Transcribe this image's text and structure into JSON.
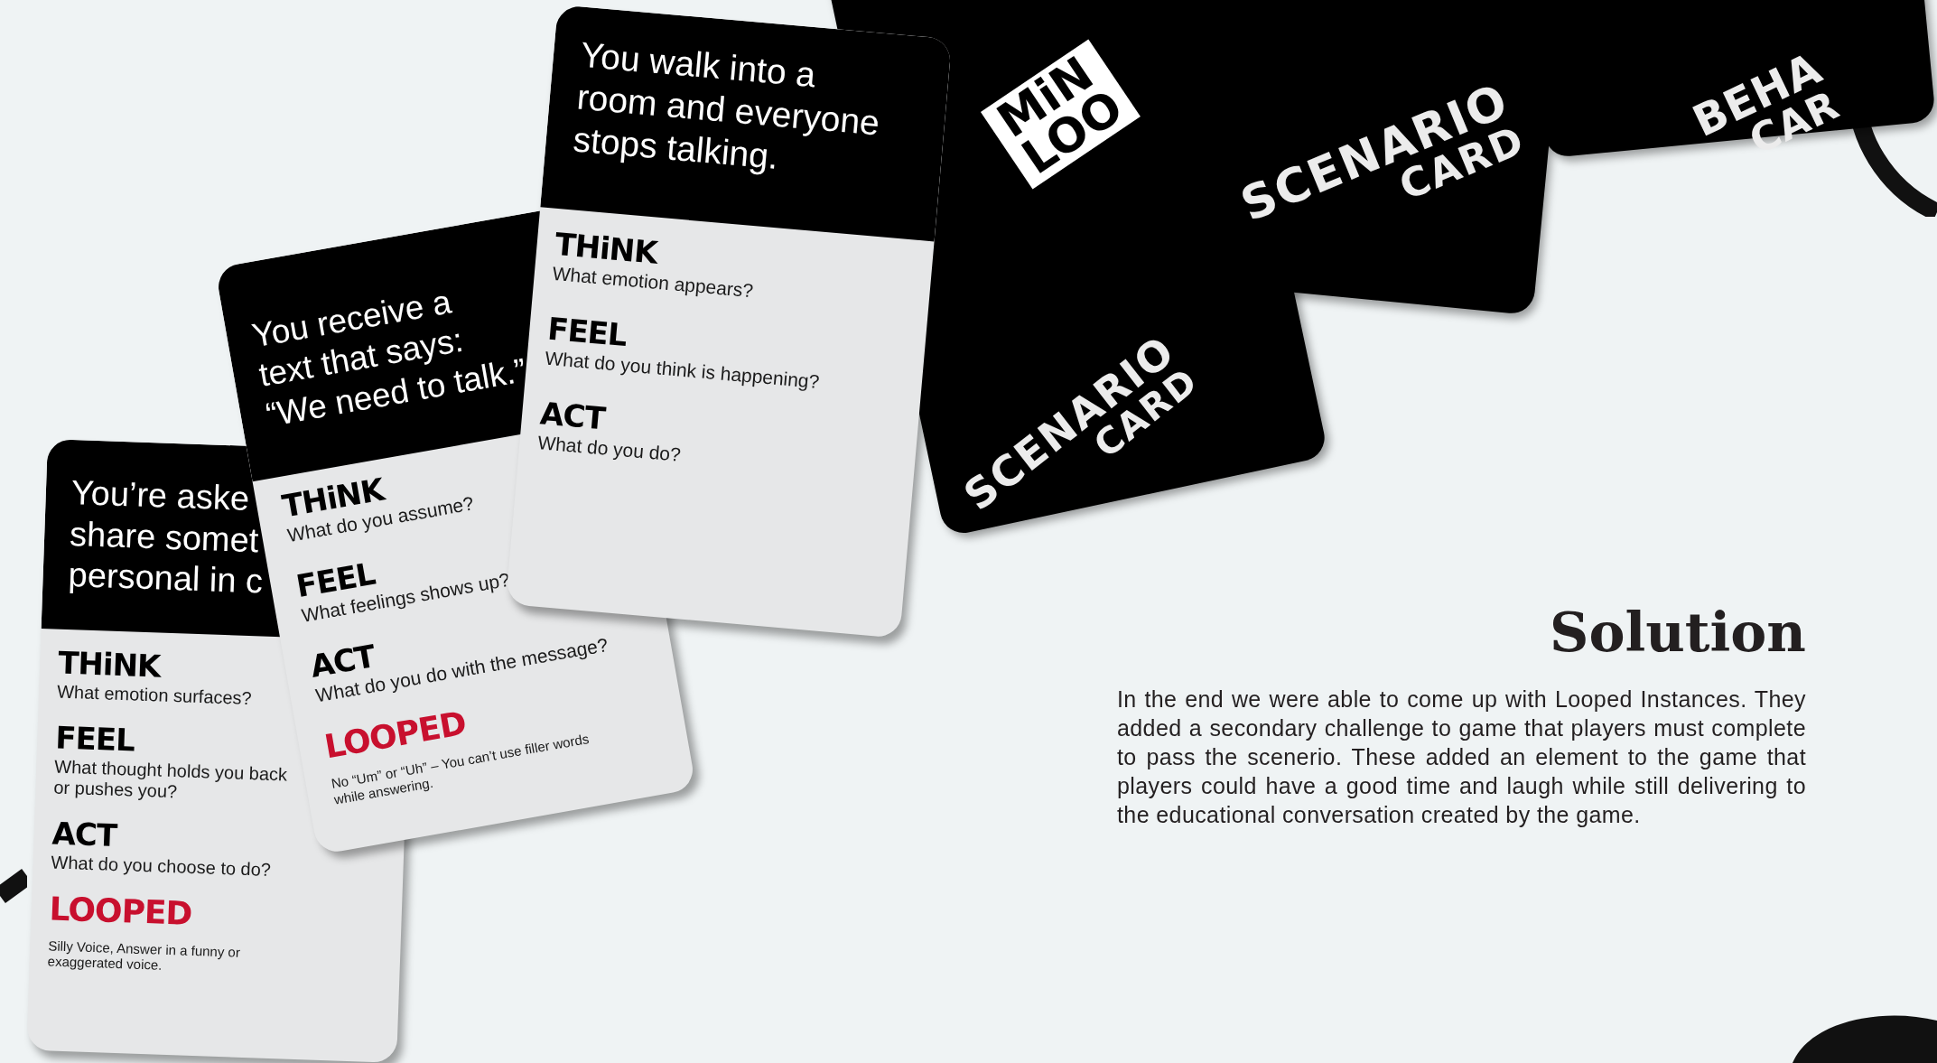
{
  "card_backs": [
    {
      "kind": "scenario",
      "logo": [
        "MiN",
        "LOO"
      ],
      "lines": [
        "SCENARIO",
        "CARD"
      ]
    },
    {
      "kind": "scenario",
      "lines": [
        "SCENARIO",
        "CARD"
      ]
    },
    {
      "kind": "behavior",
      "lines": [
        "BEHA",
        "CAR"
      ]
    }
  ],
  "cards": [
    {
      "prompt": [
        "You’re aske",
        "share somet",
        "personal in c"
      ],
      "sections": [
        {
          "kind": "step",
          "heading": "THiNK",
          "question": "What emotion surfaces?"
        },
        {
          "kind": "step",
          "heading": "FEEL",
          "question": "What thought holds you back or pushes you?"
        },
        {
          "kind": "step",
          "heading": "ACT",
          "question": "What do you choose to do?"
        },
        {
          "kind": "looped",
          "heading": "LOOPED",
          "question": "Silly Voice,  Answer in a funny or exaggerated voice."
        }
      ]
    },
    {
      "prompt": [
        "You receive a",
        "text that says:",
        "“We need to talk.”"
      ],
      "sections": [
        {
          "kind": "step",
          "heading": "THiNK",
          "question": "What do you assume?"
        },
        {
          "kind": "step",
          "heading": "FEEL",
          "question": "What feelings shows up?"
        },
        {
          "kind": "step",
          "heading": "ACT",
          "question": "What do you do with the message?"
        },
        {
          "kind": "looped",
          "heading": "LOOPED",
          "question": "No “Um” or “Uh” – You can’t use filler words while answering."
        }
      ]
    },
    {
      "prompt": [
        "You walk into a",
        "room and everyone",
        "stops talking."
      ],
      "sections": [
        {
          "kind": "step",
          "heading": "THiNK",
          "question": "What emotion appears?"
        },
        {
          "kind": "step",
          "heading": "FEEL",
          "question": "What do you think is happening?"
        },
        {
          "kind": "step",
          "heading": "ACT",
          "question": "What do you do?"
        }
      ]
    }
  ],
  "solution": {
    "title": "Solution",
    "body": "In the end we were able to come up with  Looped Instances. They added a secondary challenge to game that players must complete to pass the scenerio. These added an element to the game that players could have a good time and laugh while still delivering to the educational conversation created by the game."
  }
}
